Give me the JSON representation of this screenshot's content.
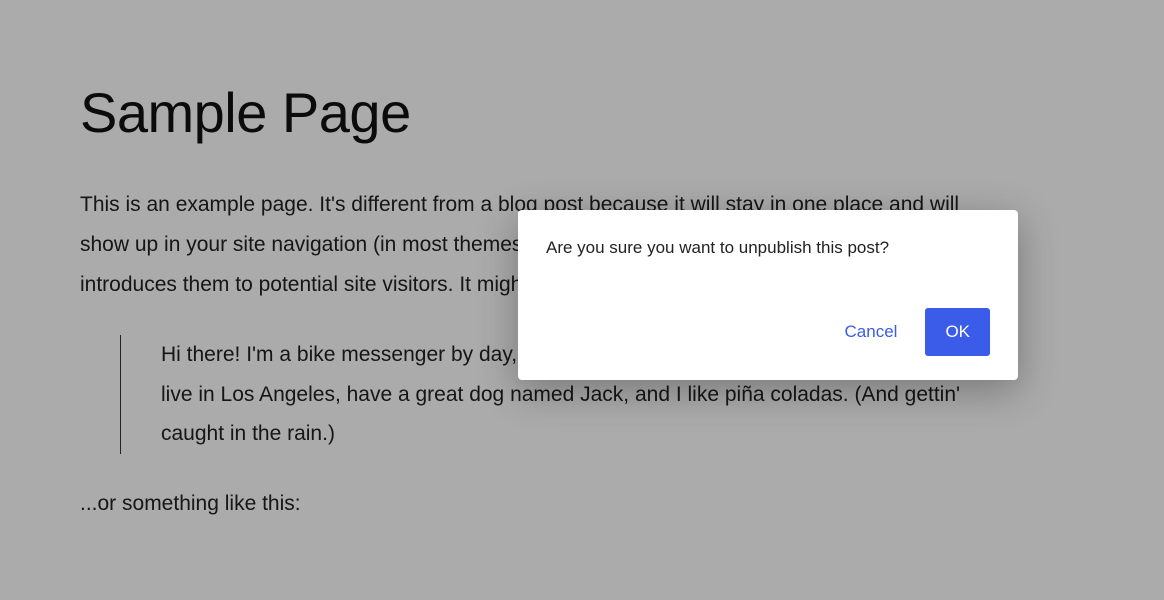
{
  "page": {
    "title": "Sample Page",
    "intro": "This is an example page. It's different from a blog post because it will stay in one place and will show up in your site navigation (in most themes). Most people start with an About page that introduces them to potential site visitors. It might say something like this:",
    "quote": "Hi there! I'm a bike messenger by day, aspiring actor by night, and this is my website. I live in Los Angeles, have a great dog named Jack, and I like piña coladas. (And gettin' caught in the rain.)",
    "closing": "...or something like this:"
  },
  "modal": {
    "message": "Are you sure you want to unpublish this post?",
    "cancel_label": "Cancel",
    "ok_label": "OK"
  }
}
